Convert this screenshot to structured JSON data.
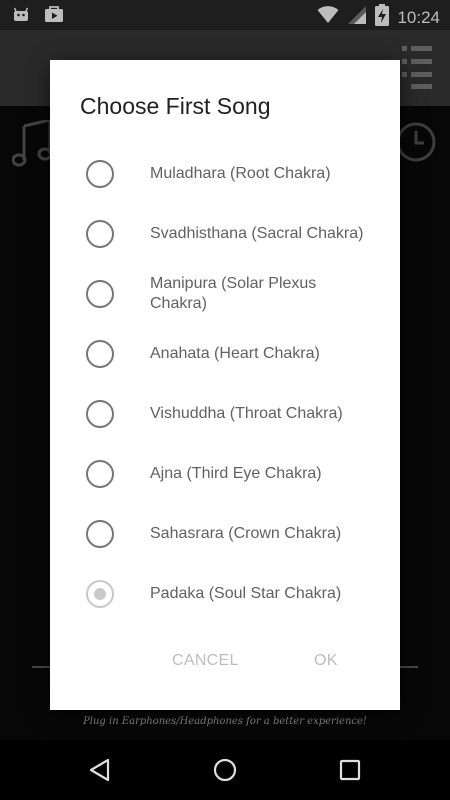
{
  "status_bar": {
    "time": "10:24",
    "left_icons": [
      "android-icon",
      "play-store-icon"
    ],
    "right_icons": [
      "wifi-icon",
      "signal-icon",
      "battery-charging-icon"
    ]
  },
  "app": {
    "footer_hint": "Plug in Earphones/Headphones for a better experience!"
  },
  "dialog": {
    "title": "Choose First Song",
    "options": [
      {
        "label": "Muladhara (Root Chakra)",
        "checked": false
      },
      {
        "label": "Svadhisthana (Sacral Chakra)",
        "checked": false
      },
      {
        "label": "Manipura (Solar Plexus Chakra)",
        "checked": false
      },
      {
        "label": "Anahata (Heart Chakra)",
        "checked": false
      },
      {
        "label": "Vishuddha (Throat Chakra)",
        "checked": false
      },
      {
        "label": "Ajna (Third Eye Chakra)",
        "checked": false
      },
      {
        "label": "Sahasrara (Crown Chakra)",
        "checked": false
      },
      {
        "label": "Padaka (Soul Star Chakra)",
        "checked": true,
        "disabled": true
      }
    ],
    "cancel_label": "CANCEL",
    "ok_label": "OK"
  },
  "colors": {
    "dialog_bg": "#ffffff",
    "title": "#212121",
    "option_text": "#616161",
    "radio_border": "#757575",
    "disabled": "#bdbdbd"
  }
}
